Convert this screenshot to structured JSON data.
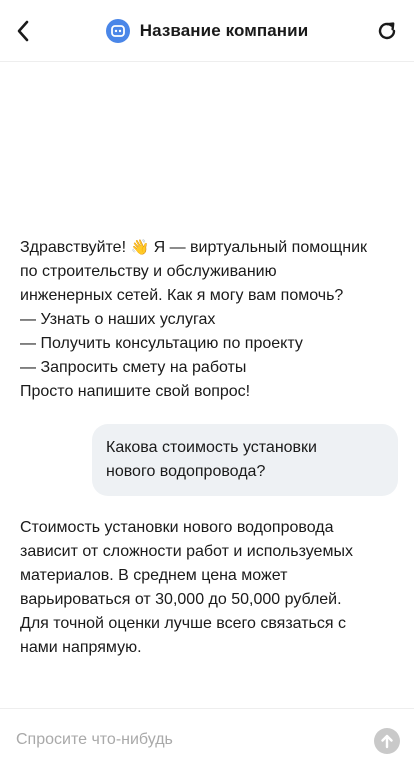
{
  "header": {
    "title": "Название компании",
    "back_icon": "chevron-left-icon",
    "bot_icon": "bot-icon",
    "refresh_icon": "refresh-icon",
    "bot_badge_color": "#4a86e8"
  },
  "messages": {
    "greeting": {
      "line1_before": "Здравствуйте! ",
      "emoji": "👋",
      "line1_after": " Я — виртуальный помощник",
      "lines": [
        "по строительству и обслуживанию",
        "инженерных сетей. Как я могу вам помочь?",
        "— Узнать о наших услугах",
        "— Получить консультацию по проекту",
        "— Запросить смету на работы",
        "Просто напишите свой вопрос!"
      ]
    },
    "user_question": {
      "lines": [
        "Какова стоимость установки",
        "нового водопровода?"
      ]
    },
    "answer": {
      "lines": [
        "Стоимость установки нового водопровода",
        "зависит от сложности работ и используемых",
        "материалов. В среднем цена может",
        "варьироваться от 30,000 до 50,000 рублей.",
        "Для точной оценки лучше всего связаться с",
        "нами напрямую."
      ]
    }
  },
  "input": {
    "placeholder": "Спросите что-нибудь",
    "value": "",
    "send_icon": "arrow-up-icon"
  }
}
